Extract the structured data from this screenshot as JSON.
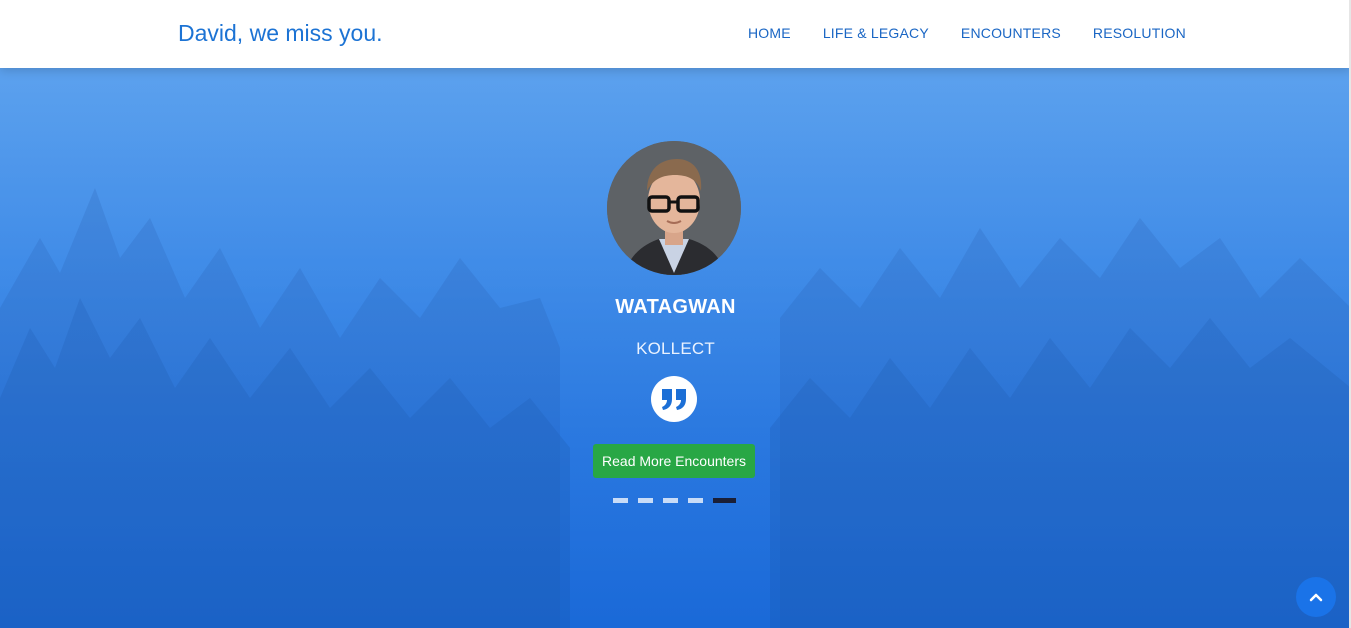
{
  "header": {
    "brand": "David, we miss you.",
    "nav": [
      {
        "label": "HOME"
      },
      {
        "label": "LIFE & LEGACY"
      },
      {
        "label": "ENCOUNTERS"
      },
      {
        "label": "RESOLUTION"
      }
    ]
  },
  "hero": {
    "name": "WATAGWAN",
    "subtitle": "KOLLECT",
    "button_label": "Read More Encounters",
    "slides_total": 5,
    "active_slide": 5
  },
  "icons": {
    "quote": "quote-right-icon",
    "back_to_top": "chevron-up-icon"
  },
  "colors": {
    "brand": "#1c73d4",
    "nav_link": "#1a66c4",
    "hero_top": "#4a97ec",
    "hero_bottom": "#1a69d8",
    "cta": "#28a745",
    "active_indicator": "#1a1f36",
    "back_to_top": "#1a73e8"
  }
}
